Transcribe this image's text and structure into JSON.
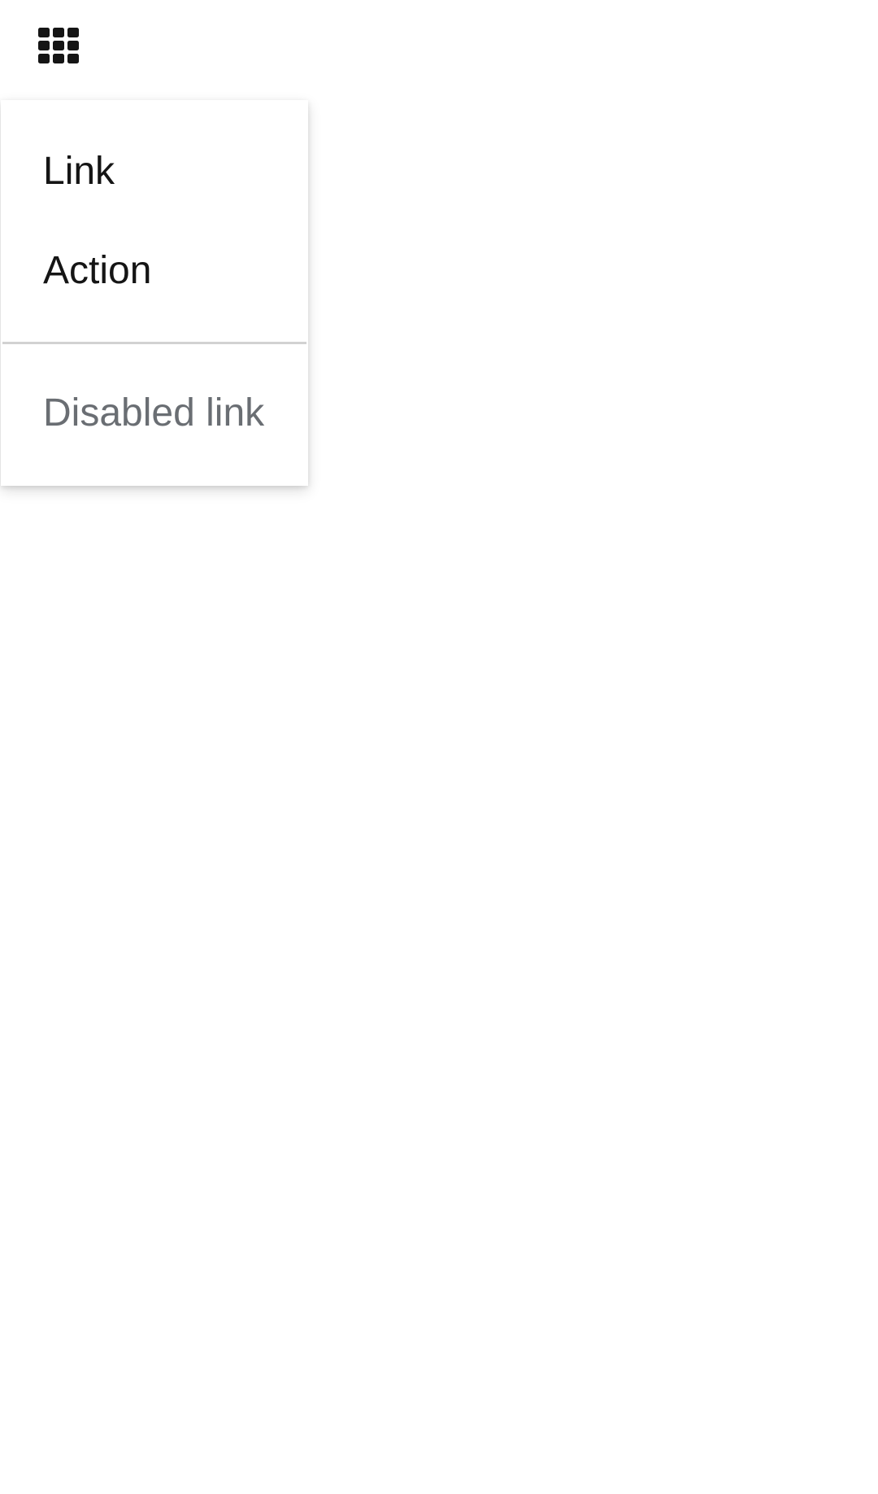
{
  "toggle": {
    "icon": "th-grid-icon",
    "color": "#151515"
  },
  "menu": {
    "items": [
      {
        "label": "Link",
        "type": "link",
        "disabled": false
      },
      {
        "label": "Action",
        "type": "action",
        "disabled": false
      },
      {
        "label": "Disabled link",
        "type": "link",
        "disabled": true
      }
    ],
    "text_color": "#151515",
    "disabled_color": "#6a6e73",
    "divider_color": "#d2d2d2"
  }
}
